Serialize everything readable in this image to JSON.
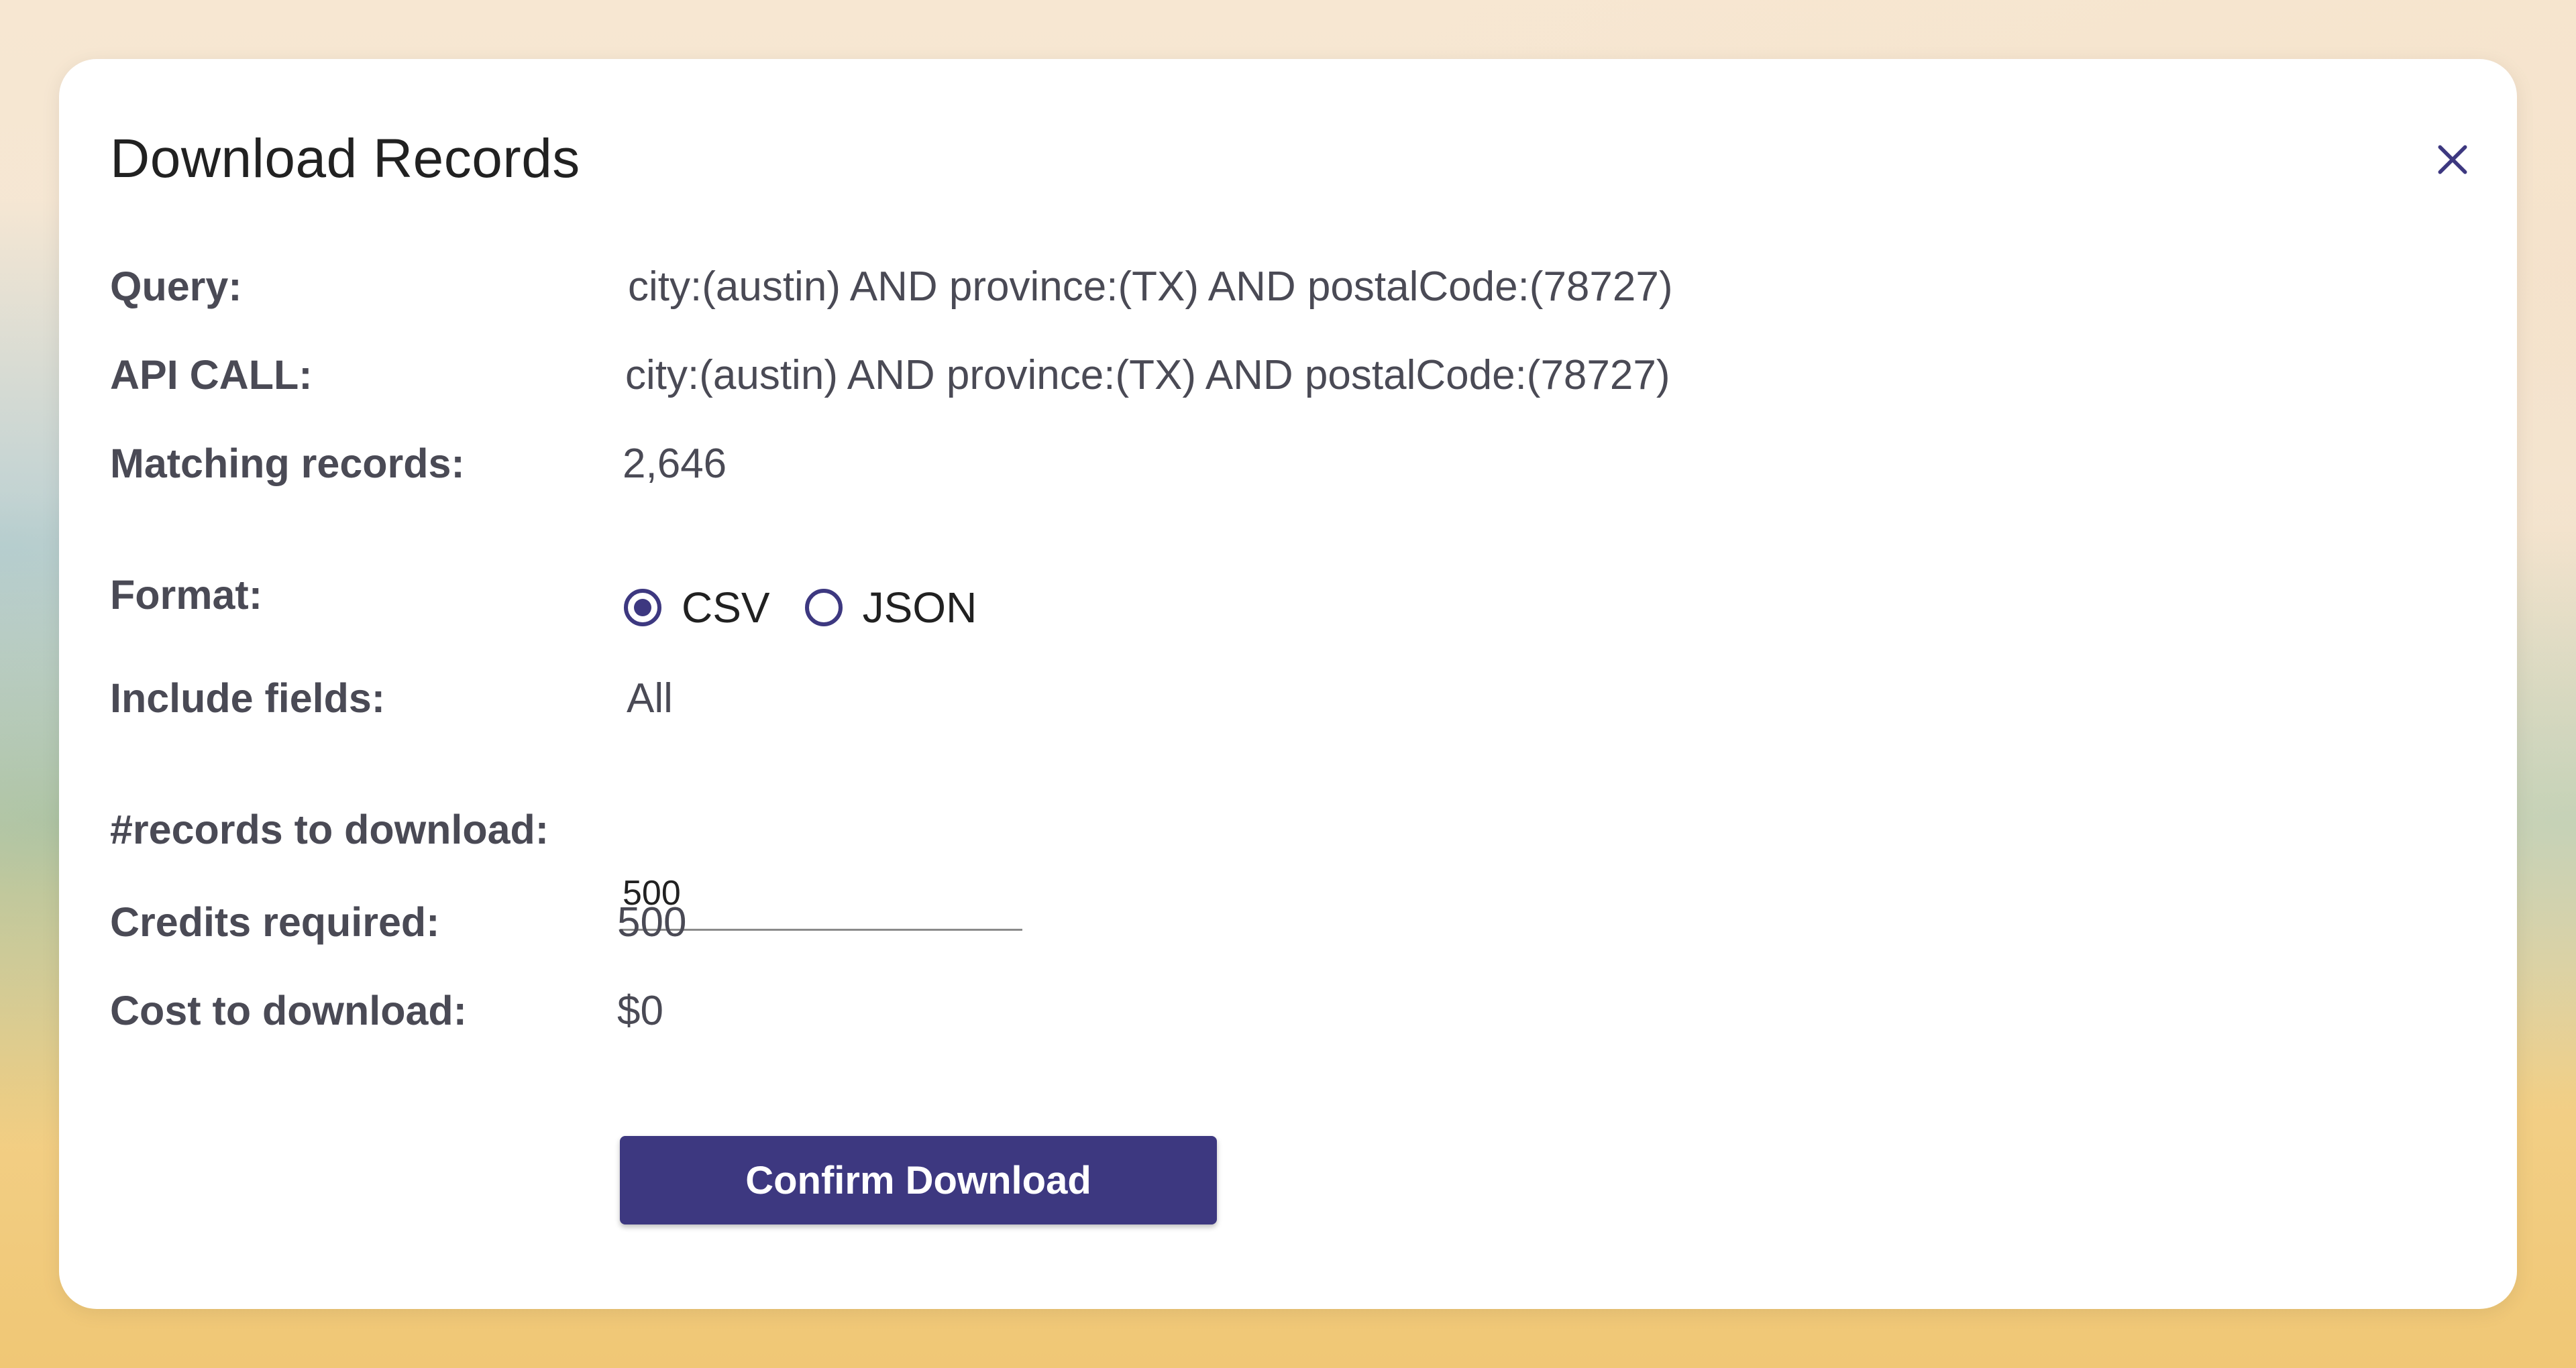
{
  "dialog": {
    "title": "Download Records",
    "close_icon": "close-icon"
  },
  "query": {
    "label": "Query:",
    "value": "city:(austin) AND province:(TX) AND postalCode:(78727)"
  },
  "api_call": {
    "label": "API CALL:",
    "value": "city:(austin) AND province:(TX) AND postalCode:(78727)"
  },
  "matching": {
    "label": "Matching records:",
    "value": "2,646"
  },
  "format": {
    "label": "Format:",
    "options": [
      {
        "label": "CSV",
        "selected": true
      },
      {
        "label": "JSON",
        "selected": false
      }
    ]
  },
  "fields": {
    "label": "Include fields:",
    "value": "All"
  },
  "records": {
    "label": "#records to download:",
    "value": "500"
  },
  "credits": {
    "label": "Credits required:",
    "value": "500"
  },
  "cost": {
    "label": "Cost to download:",
    "value": "$0"
  },
  "confirm_label": "Confirm Download",
  "colors": {
    "accent": "#3d3880",
    "label_text": "#4a4a55",
    "title_text": "#212121"
  }
}
